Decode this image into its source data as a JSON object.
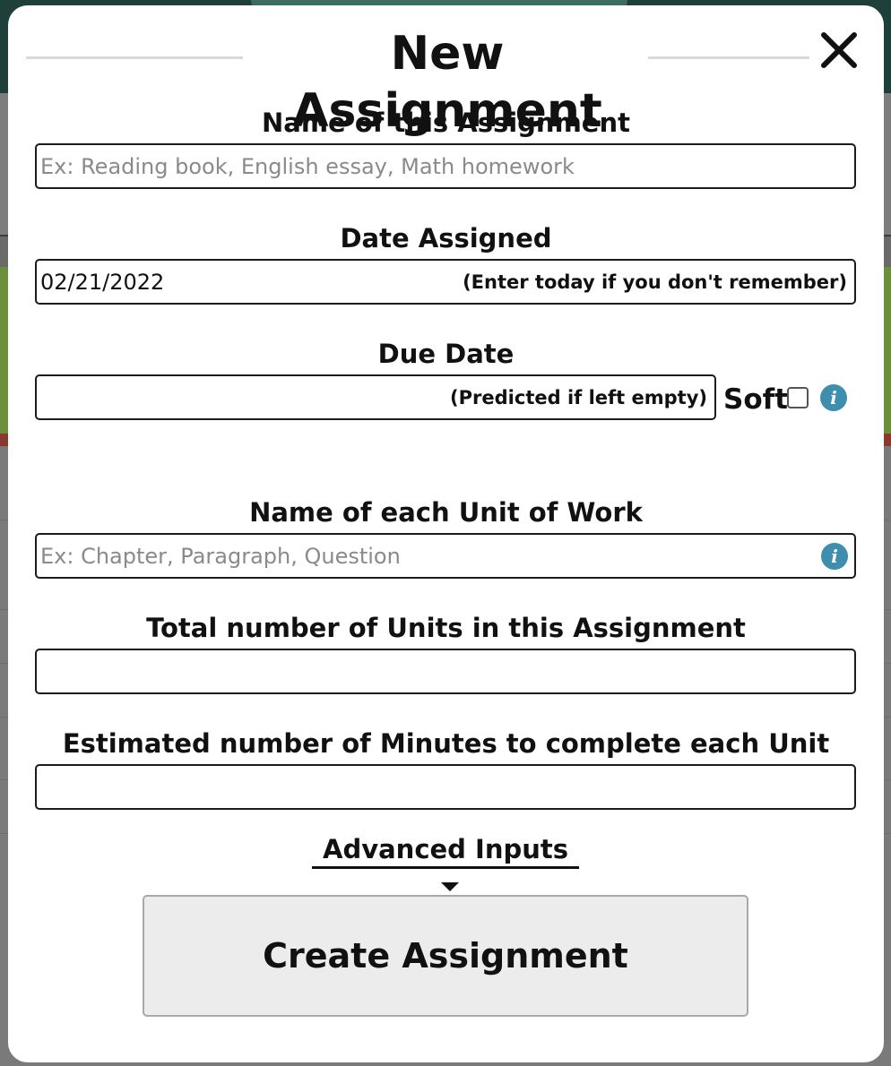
{
  "modal": {
    "title": "New Assignment",
    "close_icon": "close-icon"
  },
  "fields": {
    "name": {
      "label": "Name of this Assignment",
      "placeholder": "Ex: Reading book, English essay, Math homework",
      "value": ""
    },
    "date_assigned": {
      "label": "Date Assigned",
      "value": "02/21/2022",
      "hint": "(Enter today if you don't remember)"
    },
    "due_date": {
      "label": "Due Date",
      "value": "",
      "hint": "(Predicted if left empty)",
      "soft_label": "Soft",
      "soft_checked": false,
      "info_icon": "info-icon"
    },
    "unit_name": {
      "label": "Name of each Unit of Work",
      "placeholder": "Ex: Chapter, Paragraph, Question",
      "value": "",
      "info_icon": "info-icon"
    },
    "total_units": {
      "label": "Total number of Units in this Assignment",
      "value": ""
    },
    "minutes_per_unit": {
      "label": "Estimated number of Minutes to complete each Unit",
      "value": ""
    }
  },
  "advanced": {
    "label": "Advanced Inputs",
    "icon": "caret-down-icon"
  },
  "submit": {
    "label": "Create Assignment"
  },
  "colors": {
    "info_icon": "#3e8fae",
    "button_bg": "#ececec",
    "overlay": "#6a6a6a"
  }
}
